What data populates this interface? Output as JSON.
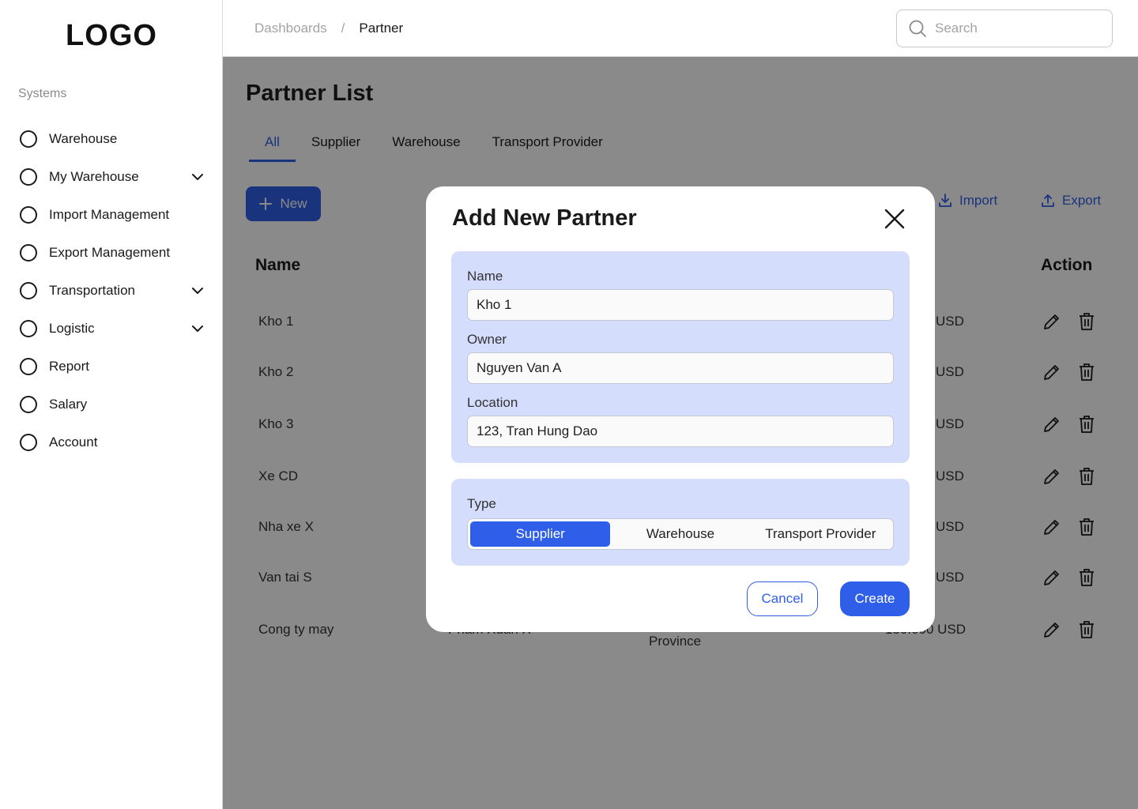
{
  "app": {
    "logo": "LOGO"
  },
  "sidebar": {
    "section_label": "Systems",
    "items": [
      {
        "label": "Warehouse",
        "icon": "circle-icon",
        "has_chevron": false
      },
      {
        "label": "My Warehouse",
        "icon": "circle-icon",
        "has_chevron": true
      },
      {
        "label": "Import Management",
        "icon": "circle-icon",
        "has_chevron": false
      },
      {
        "label": "Export Management",
        "icon": "circle-icon",
        "has_chevron": false
      },
      {
        "label": "Transportation",
        "icon": "circle-icon",
        "has_chevron": true
      },
      {
        "label": "Logistic",
        "icon": "circle-icon",
        "has_chevron": true
      },
      {
        "label": "Report",
        "icon": "circle-icon",
        "has_chevron": false
      },
      {
        "label": "Salary",
        "icon": "circle-icon",
        "has_chevron": false
      },
      {
        "label": "Account",
        "icon": "circle-icon",
        "has_chevron": false
      }
    ]
  },
  "header": {
    "breadcrumb": [
      "Dashboards",
      "/",
      "Partner"
    ],
    "search_placeholder": "Search"
  },
  "main": {
    "title": "Partner List",
    "tabs": [
      {
        "label": "All",
        "active": true
      },
      {
        "label": "Supplier",
        "active": false
      },
      {
        "label": "Warehouse",
        "active": false
      },
      {
        "label": "Transport Provider",
        "active": false
      }
    ],
    "new_button": "New",
    "import_button": "Import",
    "export_button": "Export",
    "table": {
      "headers": {
        "name": "Name",
        "action": "Action"
      },
      "rows": [
        {
          "name": "Kho 1",
          "owner": "",
          "location": "",
          "amount": "USD"
        },
        {
          "name": "Kho 2",
          "owner": "",
          "location": "",
          "amount": "USD"
        },
        {
          "name": "Kho 3",
          "owner": "",
          "location": "",
          "amount": "USD"
        },
        {
          "name": "Xe CD",
          "owner": "",
          "location": "",
          "amount": "USD"
        },
        {
          "name": "Nha xe X",
          "owner": "",
          "location": "",
          "amount": "USD"
        },
        {
          "name": "Van tai S",
          "owner": "",
          "location": "",
          "amount": "USD"
        },
        {
          "name": "Cong ty may",
          "owner": "Pham Xuan X",
          "location": "Province",
          "amount": "150.000 USD"
        }
      ]
    }
  },
  "modal": {
    "title": "Add New Partner",
    "fields": {
      "name": {
        "label": "Name",
        "value": "Kho 1"
      },
      "owner": {
        "label": "Owner",
        "value": "Nguyen Van A"
      },
      "location": {
        "label": "Location",
        "value": "123, Tran Hung Dao"
      }
    },
    "type": {
      "label": "Type",
      "options": [
        "Supplier",
        "Warehouse",
        "Transport Provider"
      ],
      "selected": "Supplier"
    },
    "cancel_label": "Cancel",
    "create_label": "Create"
  },
  "colors": {
    "accent": "#2f5fe8",
    "panel": "#d5ddfc",
    "overlay": "rgba(0,0,0,0.46)"
  }
}
